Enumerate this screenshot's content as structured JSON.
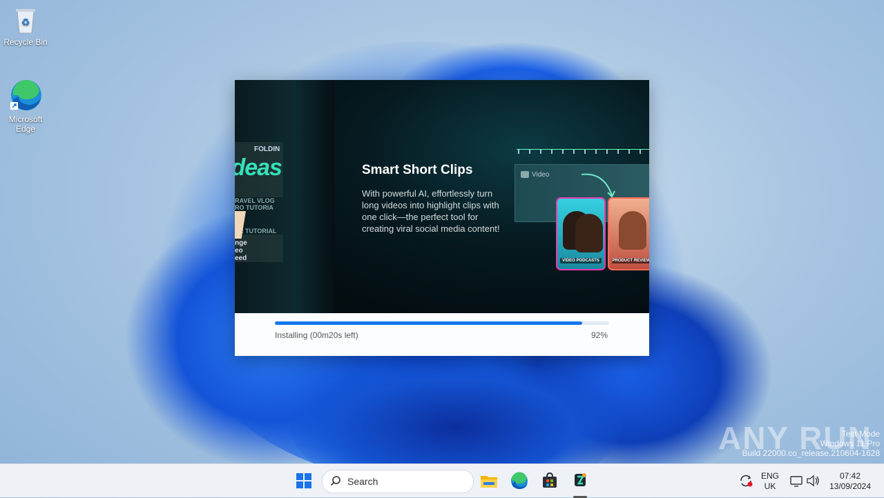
{
  "desktop": {
    "icons": [
      {
        "label": "Recycle Bin"
      },
      {
        "label": "Microsoft Edge"
      }
    ]
  },
  "installer": {
    "banner": {
      "title": "Smart Short Clips",
      "description": "With powerful AI, effortlessly turn long videos into highlight clips with one click—the perfect tool for creating viral social media content!",
      "left_strip": {
        "heading_fragment": "FOLDIN",
        "ideas_text": "Ideas",
        "lines": [
          "RAVEL VLOG",
          "RO TUTORIA",
          "ER TUTORIAL",
          "nge",
          "eo",
          "eed"
        ]
      },
      "clip_label": "Video",
      "cards": [
        {
          "caption": "VIDEO PODCASTS",
          "border": "#e83ab0"
        },
        {
          "caption": "PRODUCT REVIEWS",
          "border": "#ff6a5a"
        }
      ]
    },
    "progress": {
      "status": "Installing (00m20s left)",
      "percent_label": "92%",
      "value": 0.92
    }
  },
  "watermark": {
    "lines": [
      "Test Mode",
      "Windows 11 Pro",
      "Build 22000.co_release.210604-1628"
    ],
    "brand": "ANY RUN"
  },
  "taskbar": {
    "search_placeholder": "Search",
    "apps": [
      "start-icon",
      "file-explorer-icon",
      "edge-icon",
      "store-icon",
      "installer-app-icon"
    ],
    "tray": {
      "lang_top": "ENG",
      "lang_bottom": "UK",
      "time": "07:42",
      "date": "13/09/2024"
    }
  },
  "colors": {
    "accent": "#1478ea",
    "teal": "#37e0b8"
  }
}
